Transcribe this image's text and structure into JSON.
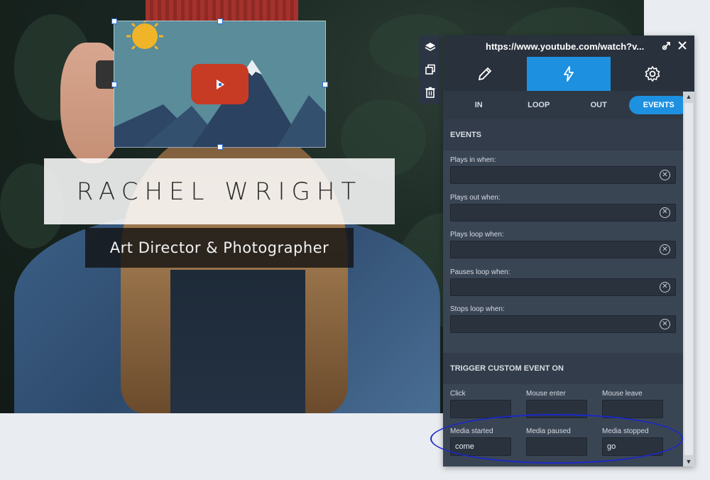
{
  "hero": {
    "name": "RACHEL WRIGHT",
    "role": "Art Director & Photographer"
  },
  "panel": {
    "url": "https://www.youtube.com/watch?v...",
    "main_tabs": [
      {
        "icon": "pencil-icon"
      },
      {
        "icon": "lightning-icon",
        "active": true
      },
      {
        "icon": "gear-icon"
      }
    ],
    "sub_tabs": [
      {
        "label": "IN"
      },
      {
        "label": "LOOP"
      },
      {
        "label": "OUT"
      },
      {
        "label": "EVENTS",
        "active": true
      }
    ],
    "events_title": "EVENTS",
    "event_fields": [
      {
        "label": "Plays in when:",
        "value": ""
      },
      {
        "label": "Plays out when:",
        "value": ""
      },
      {
        "label": "Plays loop when:",
        "value": ""
      },
      {
        "label": "Pauses loop when:",
        "value": ""
      },
      {
        "label": "Stops loop when:",
        "value": ""
      }
    ],
    "trigger_title": "TRIGGER CUSTOM EVENT ON",
    "triggers": [
      {
        "label": "Click",
        "value": ""
      },
      {
        "label": "Mouse enter",
        "value": ""
      },
      {
        "label": "Mouse leave",
        "value": ""
      },
      {
        "label": "Media started",
        "value": "come"
      },
      {
        "label": "Media paused",
        "value": ""
      },
      {
        "label": "Media stopped",
        "value": "go"
      }
    ]
  },
  "colors": {
    "accent": "#1e90e0",
    "panel_bg": "#3a4554",
    "annotation": "#1c28c8",
    "play_button": "#c73b25"
  }
}
